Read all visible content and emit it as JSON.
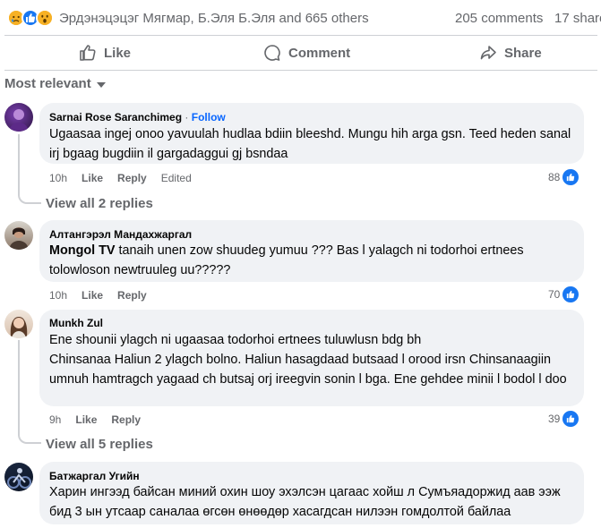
{
  "summary": {
    "reaction_icons": [
      "sad-reaction",
      "like-reaction",
      "wow-reaction"
    ],
    "reactors_text": "Эрдэнэцэцэг Мягмар, Б.Эля Б.Эля and 665 others",
    "comments_count": "205 comments",
    "shares_count": "17 shares"
  },
  "actions": {
    "like": "Like",
    "comment": "Comment",
    "share": "Share"
  },
  "sort": {
    "label": "Most relevant"
  },
  "comments": [
    {
      "author": "Sarnai Rose Saranchimeg",
      "follow": "Follow",
      "text": "Ugaasaa ingej onoo yavuulah hudlaa bdiin bleeshd. Mungu hih arga gsn. Teed heden sanal irj bgaag bugdiin il gargadaggui gj bsndaa",
      "time": "10h",
      "like": "Like",
      "reply": "Reply",
      "edited": "Edited",
      "reactions": "88",
      "replies": "View all 2 replies"
    },
    {
      "author": "Алтангэрэл Мандахжаргал",
      "tag": "Mongol TV",
      "text": " tanaih unen zow shuudeg yumuu ??? Bas l yalagch ni todorhoi ertnees tolowloson newtruuleg uu?????",
      "time": "10h",
      "like": "Like",
      "reply": "Reply",
      "reactions": "70"
    },
    {
      "author": "Munkh Zul",
      "text": "Ene shounii ylagch ni ugaasaa todorhoi ertnees tuluwlusn bdg bh",
      "text2": "Chinsanaa Haliun 2 ylagch bolno. Haliun hasagdaad butsaad l orood irsn Chinsanaagiin umnuh hamtragch yagaad ch butsaj orj ireegvin sonin l bga. Ene gehdee minii l bodol l doo",
      "time": "9h",
      "like": "Like",
      "reply": "Reply",
      "reactions": "39",
      "replies": "View all 5 replies"
    },
    {
      "author": "Батжаргал Угийн",
      "text": "Харин ингээд байсан миний охин шоу эхэлсэн цагаас хойш л Сумъяадоржид аав ээж бид 3 ын утсаар саналаа өгсөн өнөөдөр хасагдсан нилээн гомдолтой байлаа"
    }
  ],
  "colors": {
    "accent": "#1877f2",
    "follow": "#0866ff",
    "bubble": "#f0f2f5",
    "muted": "#65676b"
  }
}
